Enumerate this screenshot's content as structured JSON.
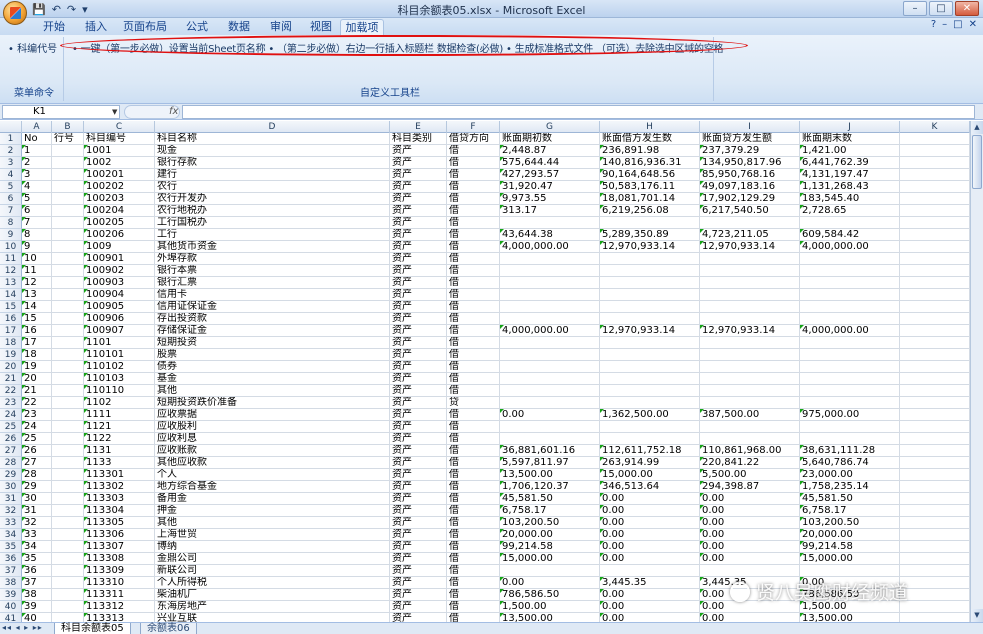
{
  "window": {
    "title": "科目余额表05.xlsx - Microsoft Excel",
    "controls": [
      "–",
      "□",
      "✕"
    ],
    "qat": [
      "💾",
      "↶",
      "↷",
      "▾"
    ]
  },
  "ribbon": {
    "tabs": [
      "开始",
      "插入",
      "页面布局",
      "公式",
      "数据",
      "审阅",
      "视图",
      "加载项"
    ],
    "active_tab": "加载项",
    "help": [
      "?",
      "–",
      "□",
      "✕"
    ],
    "group1": {
      "button": "• 科编代号",
      "label": "菜单命令"
    },
    "group2": {
      "tools": "• 一键（第一步必做）设置当前Sheet页名称 • （第二步必做）右边一行插入标题栏 数据检查(必做) • 生成标准格式文件 （可选）去除选中区域的空格",
      "label": "自定义工具栏"
    }
  },
  "formula_bar": {
    "name_box": "K1",
    "fx": "fx",
    "content": ""
  },
  "grid": {
    "columns": [
      "A",
      "B",
      "C",
      "D",
      "E",
      "F",
      "G",
      "H",
      "I",
      "J",
      "K"
    ],
    "rows": [
      {
        "n": "1",
        "c": [
          "No",
          "行号",
          "科目编号",
          "科目名称",
          "科目类别",
          "借贷方向",
          "账面期初数",
          "账面借方发生数",
          "账面贷方发生额",
          "账面期末数",
          ""
        ]
      },
      {
        "n": "2",
        "c": [
          "1",
          "",
          "1001",
          "现金",
          "资产",
          "借",
          "2,448.87",
          "236,891.98",
          "237,379.29",
          "1,421.00",
          ""
        ]
      },
      {
        "n": "3",
        "c": [
          "2",
          "",
          "1002",
          "银行存款",
          "资产",
          "借",
          "575,644.44",
          "140,816,936.31",
          "134,950,817.96",
          "6,441,762.39",
          ""
        ]
      },
      {
        "n": "4",
        "c": [
          "3",
          "",
          "100201",
          "建行",
          "资产",
          "借",
          "427,293.57",
          "90,164,648.56",
          "85,950,768.16",
          "4,131,197.47",
          ""
        ]
      },
      {
        "n": "5",
        "c": [
          "4",
          "",
          "100202",
          "农行",
          "资产",
          "借",
          "31,920.47",
          "50,583,176.11",
          "49,097,183.16",
          "1,131,268.43",
          ""
        ]
      },
      {
        "n": "6",
        "c": [
          "5",
          "",
          "100203",
          "农行开发办",
          "资产",
          "借",
          "9,973.55",
          "18,081,701.14",
          "17,902,129.29",
          "183,545.40",
          ""
        ]
      },
      {
        "n": "7",
        "c": [
          "6",
          "",
          "100204",
          "农行地税办",
          "资产",
          "借",
          "313.17",
          "6,219,256.08",
          "6,217,540.50",
          "2,728.65",
          ""
        ]
      },
      {
        "n": "8",
        "c": [
          "7",
          "",
          "100205",
          "工行国税办",
          "资产",
          "借",
          "",
          "",
          "",
          "",
          ""
        ]
      },
      {
        "n": "9",
        "c": [
          "8",
          "",
          "100206",
          "工行",
          "资产",
          "借",
          "43,644.38",
          "5,289,350.89",
          "4,723,211.05",
          "609,584.42",
          ""
        ]
      },
      {
        "n": "10",
        "c": [
          "9",
          "",
          "1009",
          "其他货币资金",
          "资产",
          "借",
          "4,000,000.00",
          "12,970,933.14",
          "12,970,933.14",
          "4,000,000.00",
          ""
        ]
      },
      {
        "n": "11",
        "c": [
          "10",
          "",
          "100901",
          "外埠存款",
          "资产",
          "借",
          "",
          "",
          "",
          "",
          ""
        ]
      },
      {
        "n": "12",
        "c": [
          "11",
          "",
          "100902",
          "银行本票",
          "资产",
          "借",
          "",
          "",
          "",
          "",
          ""
        ]
      },
      {
        "n": "13",
        "c": [
          "12",
          "",
          "100903",
          "银行汇票",
          "资产",
          "借",
          "",
          "",
          "",
          "",
          ""
        ]
      },
      {
        "n": "14",
        "c": [
          "13",
          "",
          "100904",
          "信用卡",
          "资产",
          "借",
          "",
          "",
          "",
          "",
          ""
        ]
      },
      {
        "n": "15",
        "c": [
          "14",
          "",
          "100905",
          "信用证保证金",
          "资产",
          "借",
          "",
          "",
          "",
          "",
          ""
        ]
      },
      {
        "n": "16",
        "c": [
          "15",
          "",
          "100906",
          "存出投资款",
          "资产",
          "借",
          "",
          "",
          "",
          "",
          ""
        ]
      },
      {
        "n": "17",
        "c": [
          "16",
          "",
          "100907",
          "存储保证金",
          "资产",
          "借",
          "4,000,000.00",
          "12,970,933.14",
          "12,970,933.14",
          "4,000,000.00",
          ""
        ]
      },
      {
        "n": "18",
        "c": [
          "17",
          "",
          "1101",
          "短期投资",
          "资产",
          "借",
          "",
          "",
          "",
          "",
          ""
        ]
      },
      {
        "n": "19",
        "c": [
          "18",
          "",
          "110101",
          "股票",
          "资产",
          "借",
          "",
          "",
          "",
          "",
          ""
        ]
      },
      {
        "n": "20",
        "c": [
          "19",
          "",
          "110102",
          "债券",
          "资产",
          "借",
          "",
          "",
          "",
          "",
          ""
        ]
      },
      {
        "n": "21",
        "c": [
          "20",
          "",
          "110103",
          "基金",
          "资产",
          "借",
          "",
          "",
          "",
          "",
          ""
        ]
      },
      {
        "n": "22",
        "c": [
          "21",
          "",
          "110110",
          "其他",
          "资产",
          "借",
          "",
          "",
          "",
          "",
          ""
        ]
      },
      {
        "n": "23",
        "c": [
          "22",
          "",
          "1102",
          "短期投资跌价准备",
          "资产",
          "贷",
          "",
          "",
          "",
          "",
          ""
        ]
      },
      {
        "n": "24",
        "c": [
          "23",
          "",
          "1111",
          "应收票据",
          "资产",
          "借",
          "0.00",
          "1,362,500.00",
          "387,500.00",
          "975,000.00",
          ""
        ]
      },
      {
        "n": "25",
        "c": [
          "24",
          "",
          "1121",
          "应收股利",
          "资产",
          "借",
          "",
          "",
          "",
          "",
          ""
        ]
      },
      {
        "n": "26",
        "c": [
          "25",
          "",
          "1122",
          "应收利息",
          "资产",
          "借",
          "",
          "",
          "",
          "",
          ""
        ]
      },
      {
        "n": "27",
        "c": [
          "26",
          "",
          "1131",
          "应收账款",
          "资产",
          "借",
          "36,881,601.16",
          "112,611,752.18",
          "110,861,968.00",
          "38,631,111.28",
          ""
        ]
      },
      {
        "n": "28",
        "c": [
          "27",
          "",
          "1133",
          "其他应收款",
          "资产",
          "借",
          "5,597,811.97",
          "263,914.99",
          "220,841.22",
          "5,640,786.74",
          ""
        ]
      },
      {
        "n": "29",
        "c": [
          "28",
          "",
          "113301",
          "个人",
          "资产",
          "借",
          "13,500.00",
          "15,000.00",
          "5,500.00",
          "23,000.00",
          ""
        ]
      },
      {
        "n": "30",
        "c": [
          "29",
          "",
          "113302",
          "地方综合基金",
          "资产",
          "借",
          "1,706,120.37",
          "346,513.64",
          "294,398.87",
          "1,758,235.14",
          ""
        ]
      },
      {
        "n": "31",
        "c": [
          "30",
          "",
          "113303",
          "备用金",
          "资产",
          "借",
          "45,581.50",
          "0.00",
          "0.00",
          "45,581.50",
          ""
        ]
      },
      {
        "n": "32",
        "c": [
          "31",
          "",
          "113304",
          "押金",
          "资产",
          "借",
          "6,758.17",
          "0.00",
          "0.00",
          "6,758.17",
          ""
        ]
      },
      {
        "n": "33",
        "c": [
          "32",
          "",
          "113305",
          "其他",
          "资产",
          "借",
          "103,200.50",
          "0.00",
          "0.00",
          "103,200.50",
          ""
        ]
      },
      {
        "n": "34",
        "c": [
          "33",
          "",
          "113306",
          "上海世贸",
          "资产",
          "借",
          "20,000.00",
          "0.00",
          "0.00",
          "20,000.00",
          ""
        ]
      },
      {
        "n": "35",
        "c": [
          "34",
          "",
          "113307",
          "博纳",
          "资产",
          "借",
          "99,214.58",
          "0.00",
          "0.00",
          "99,214.58",
          ""
        ]
      },
      {
        "n": "36",
        "c": [
          "35",
          "",
          "113308",
          "金鼎公司",
          "资产",
          "借",
          "15,000.00",
          "0.00",
          "0.00",
          "15,000.00",
          ""
        ]
      },
      {
        "n": "37",
        "c": [
          "36",
          "",
          "113309",
          "新联公司",
          "资产",
          "借",
          "",
          "",
          "",
          "",
          ""
        ]
      },
      {
        "n": "38",
        "c": [
          "37",
          "",
          "113310",
          "个人所得税",
          "资产",
          "借",
          "0.00",
          "3,445.35",
          "3,445.35",
          "0.00",
          ""
        ]
      },
      {
        "n": "39",
        "c": [
          "38",
          "",
          "113311",
          "柴油机厂",
          "资产",
          "借",
          "786,586.50",
          "0.00",
          "0.00",
          "786,586.50",
          ""
        ]
      },
      {
        "n": "40",
        "c": [
          "39",
          "",
          "113312",
          "东海房地产",
          "资产",
          "借",
          "1,500.00",
          "0.00",
          "0.00",
          "1,500.00",
          ""
        ]
      },
      {
        "n": "41",
        "c": [
          "40",
          "",
          "113313",
          "兴业互联",
          "资产",
          "借",
          "13,500.00",
          "0.00",
          "0.00",
          "13,500.00",
          ""
        ]
      }
    ]
  },
  "sheets": {
    "nav": "◂◂ ◂ ▸ ▸▸",
    "tabs": [
      "科目余额表05",
      "余额表06"
    ],
    "active": "科目余额表05"
  },
  "watermark": "贤八吴鹰财经频道",
  "colors": {
    "ribbon_bg": "#dbe8f6",
    "highlight_ellipse": "#e01010",
    "error_triangle": "#16a316"
  }
}
